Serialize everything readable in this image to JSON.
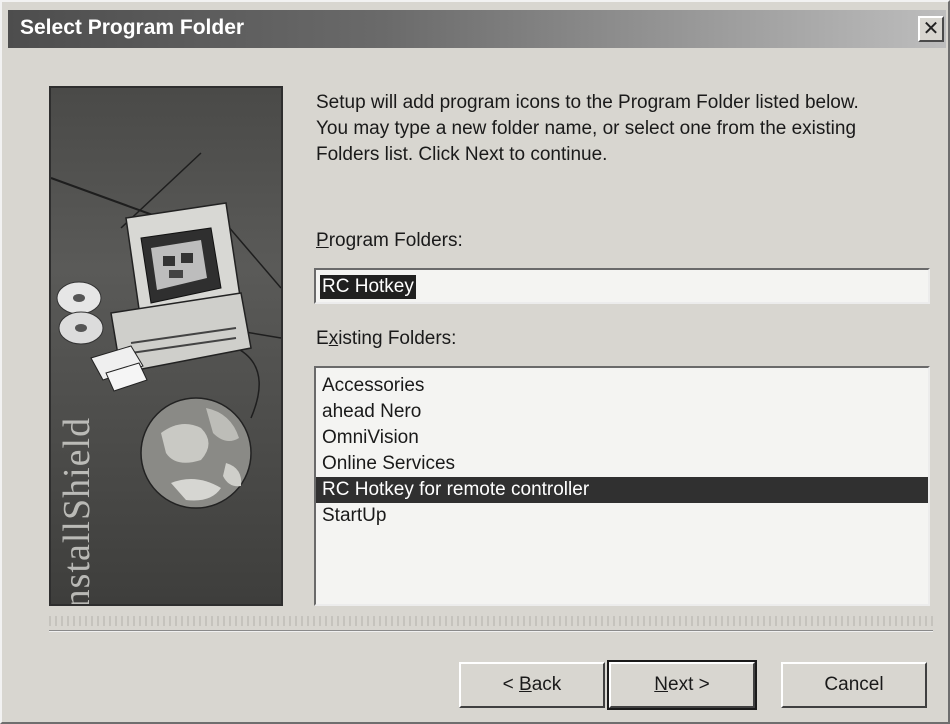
{
  "window": {
    "title": "Select Program Folder",
    "close_glyph": "✕"
  },
  "sidebar_image": {
    "brand_text": "InstallShield",
    "icons": [
      "computer-icon",
      "cd-disc-icon",
      "floppy-disk-icon",
      "globe-icon"
    ]
  },
  "description": {
    "line1": "Setup will add program icons to the Program Folder listed below.",
    "line2": "You may type a new folder name, or select one from the existing",
    "line3": "Folders list.  Click Next to continue."
  },
  "program_folders": {
    "label_mnemonic": "P",
    "label_rest": "rogram Folders:",
    "value": "RC Hotkey"
  },
  "existing_folders": {
    "label_first": "E",
    "label_mnemonic": "x",
    "label_rest": "isting Folders:",
    "items": [
      {
        "label": "Accessories"
      },
      {
        "label": "ahead Nero"
      },
      {
        "label": "OmniVision"
      },
      {
        "label": "Online Services"
      },
      {
        "label": "RC Hotkey for remote controller"
      },
      {
        "label": "StartUp"
      }
    ],
    "selected_label": "RC Hotkey for remote controller"
  },
  "buttons": {
    "back_prefix": "< ",
    "back_mnemonic": "B",
    "back_rest": "ack",
    "next_mnemonic": "N",
    "next_rest": "ext >",
    "cancel": "Cancel"
  },
  "colors": {
    "titlebar_dark": "#4d4d4d",
    "selection": "#303030",
    "face": "#d8d6d0"
  }
}
